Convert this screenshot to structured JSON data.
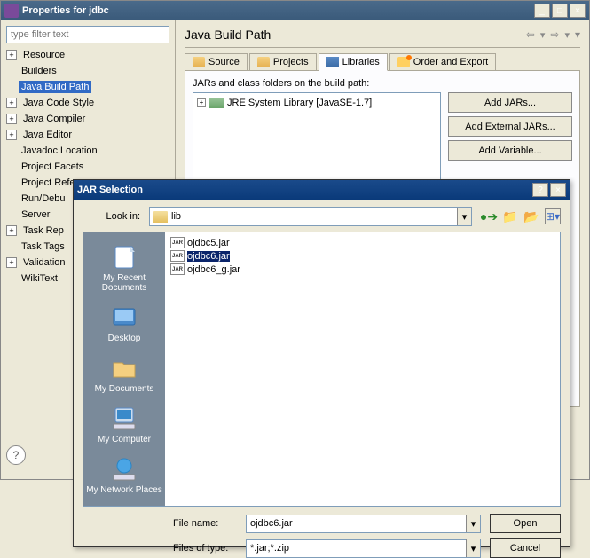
{
  "mainWindow": {
    "title": "Properties for jdbc",
    "filterPlaceholder": "type filter text",
    "tree": {
      "resource": "Resource",
      "builders": "Builders",
      "buildPath": "Java Build Path",
      "codeStyle": "Java Code Style",
      "compiler": "Java Compiler",
      "editor": "Java Editor",
      "javadoc": "Javadoc Location",
      "facets": "Project Facets",
      "refs": "Project References",
      "runDebug": "Run/Debu",
      "server": "Server",
      "taskRepo": "Task Rep",
      "taskTags": "Task Tags",
      "validation": "Validation",
      "wikitext": "WikiText"
    },
    "pageTitle": "Java Build Path",
    "tabs": {
      "source": "Source",
      "projects": "Projects",
      "libraries": "Libraries",
      "order": "Order and Export"
    },
    "jarsLabel": "JARs and class folders on the build path:",
    "jre": "JRE System Library [JavaSE-1.7]",
    "buttons": {
      "addJars": "Add JARs...",
      "addExternal": "Add External JARs...",
      "addVariable": "Add Variable..."
    }
  },
  "dialog": {
    "title": "JAR Selection",
    "lookIn": "Look in:",
    "folder": "lib",
    "places": {
      "recent": "My Recent Documents",
      "desktop": "Desktop",
      "mydocs": "My Documents",
      "mycomp": "My Computer",
      "network": "My Network Places"
    },
    "files": {
      "f1": "ojdbc5.jar",
      "f2": "ojdbc6.jar",
      "f3": "ojdbc6_g.jar"
    },
    "fileNameLabel": "File name:",
    "fileName": "ojdbc6.jar",
    "fileTypeLabel": "Files of type:",
    "fileType": "*.jar;*.zip",
    "open": "Open",
    "cancel": "Cancel"
  }
}
